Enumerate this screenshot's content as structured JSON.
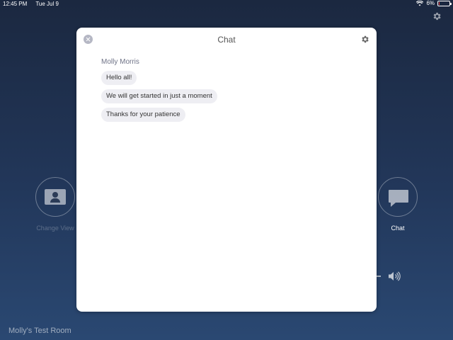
{
  "status_bar": {
    "time": "12:45 PM",
    "date": "Tue Jul 9",
    "battery": "6%",
    "battery_level": 0.06
  },
  "background": {
    "change_view_label": "Change View",
    "chat_label": "Chat",
    "room_name": "Molly's Test Room"
  },
  "chat_modal": {
    "title": "Chat",
    "sender": "Molly Morris",
    "messages": [
      "Hello all!",
      "We will get started in just a moment",
      "Thanks for your patience"
    ]
  },
  "icons": [
    "wifi-icon",
    "battery-icon",
    "gear-icon",
    "close-icon",
    "change-view-icon",
    "chat-icon",
    "speaker-icon"
  ],
  "colors": {
    "accent_dark": "#1b2840",
    "bubble": "#eeeef3",
    "close_button": "#b5b7c4"
  }
}
